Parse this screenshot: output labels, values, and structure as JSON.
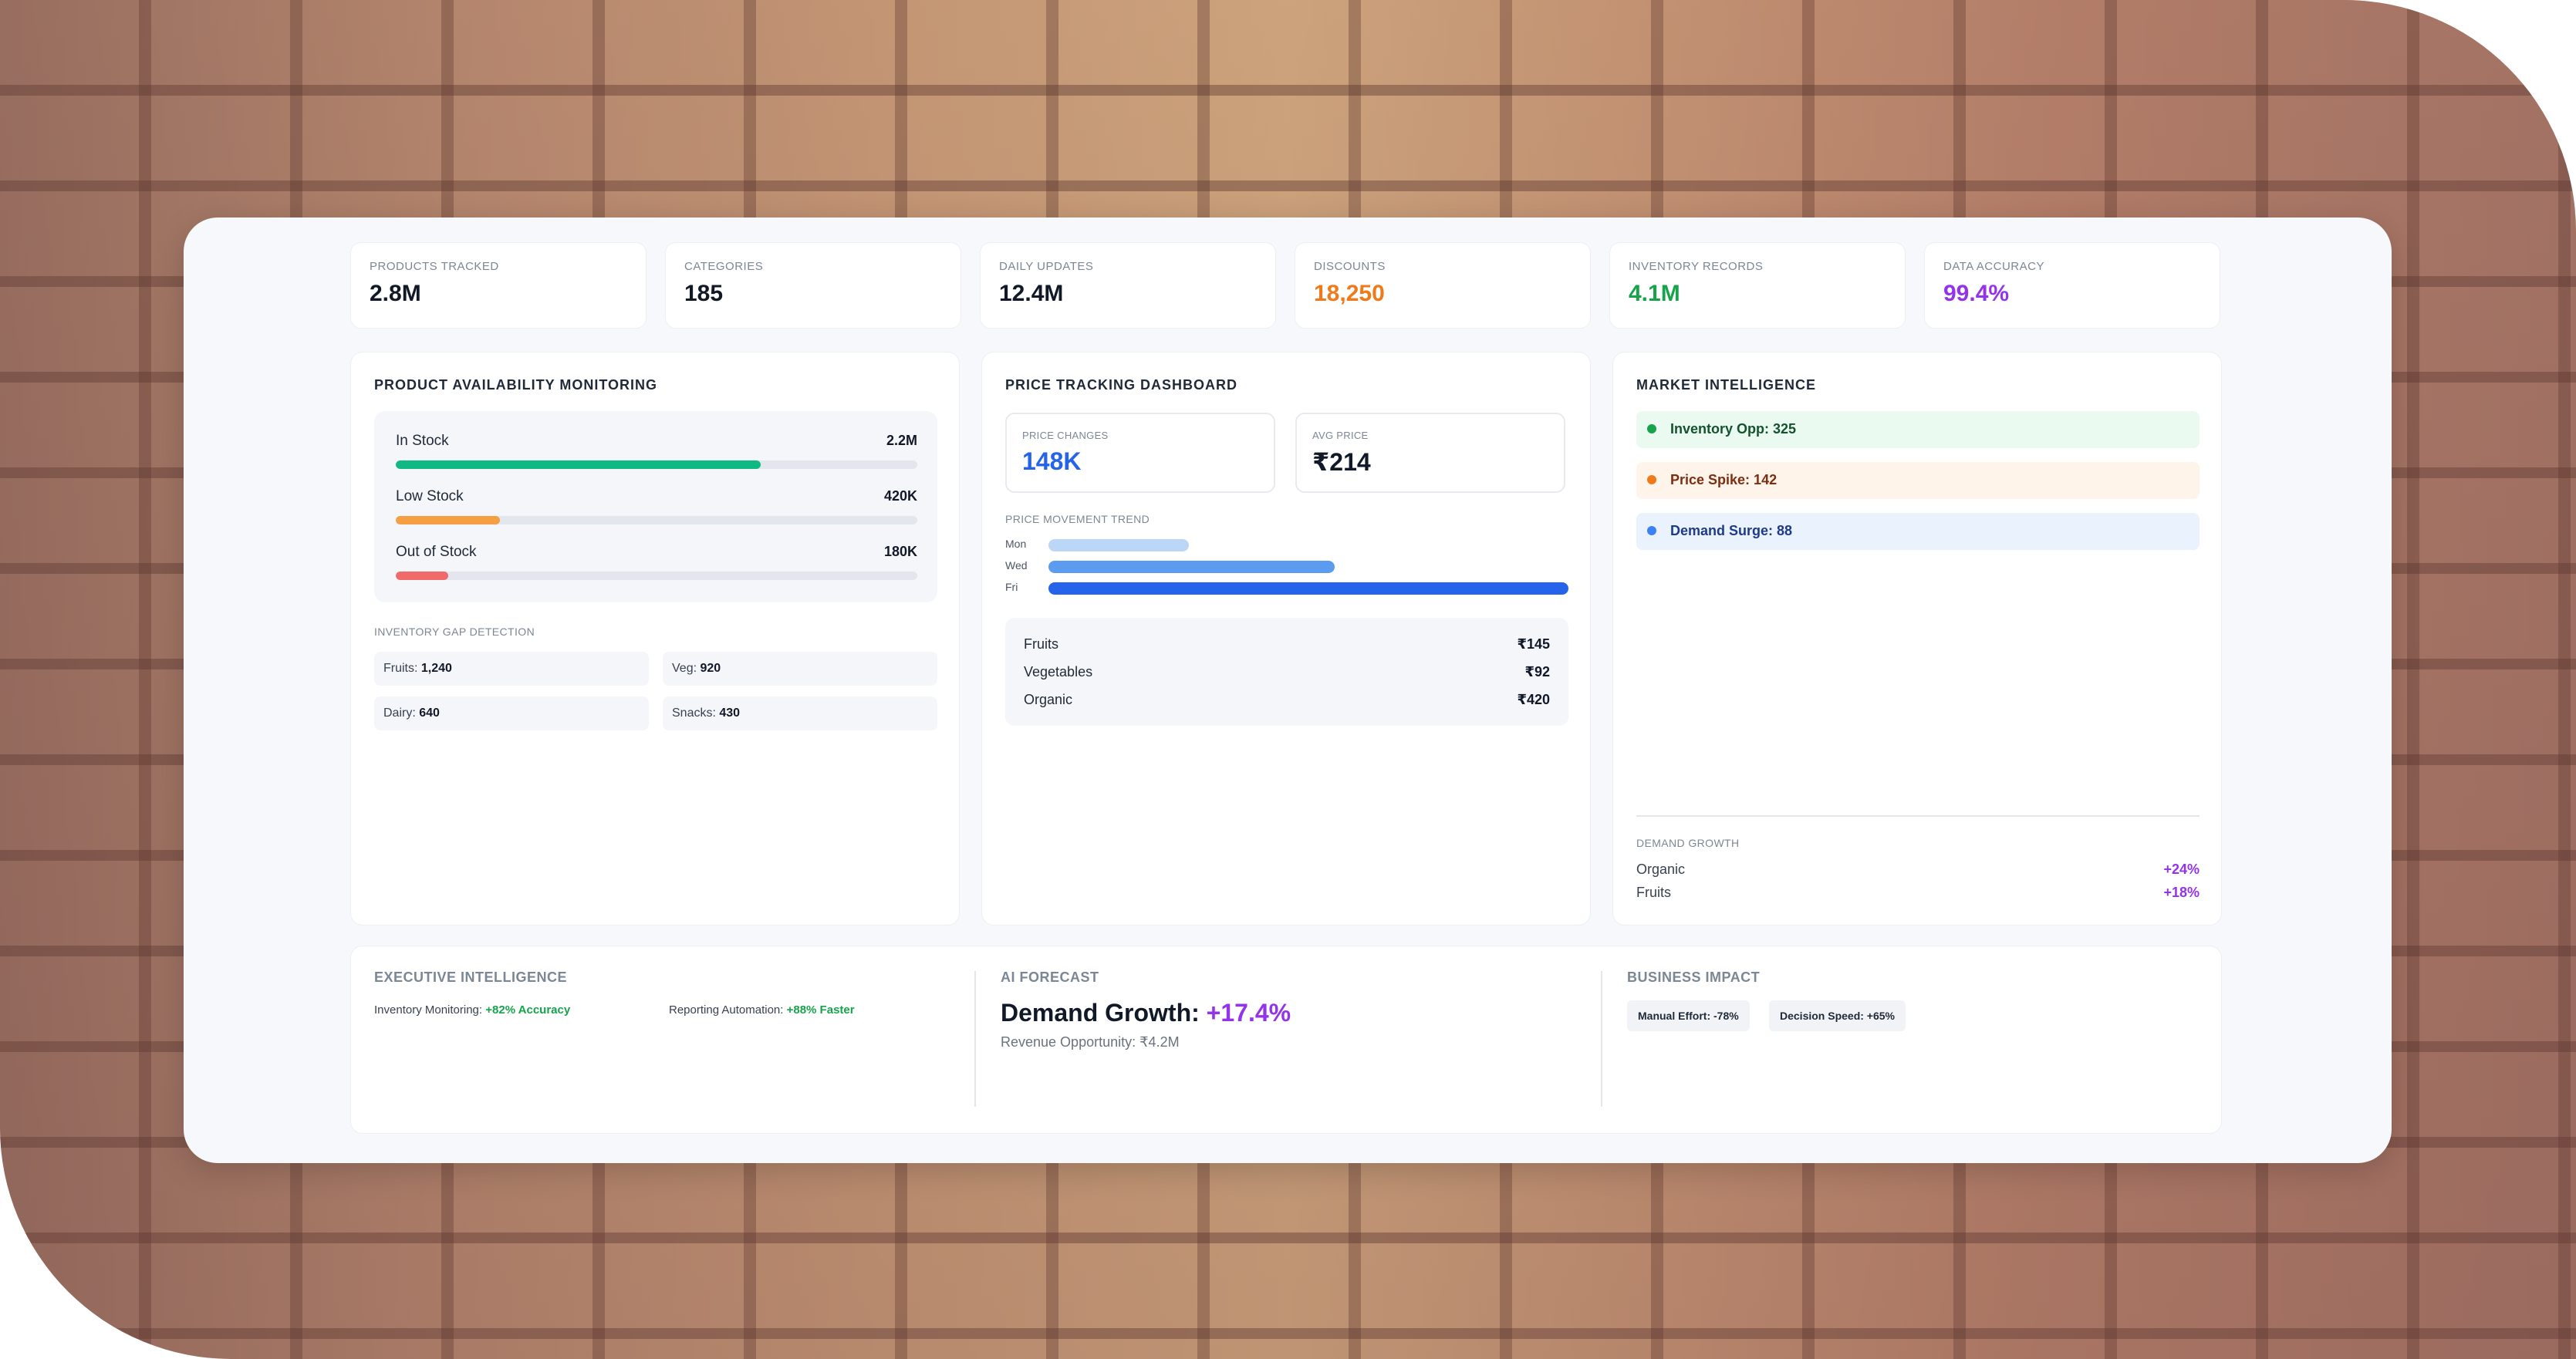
{
  "kpis": [
    {
      "label": "PRODUCTS TRACKED",
      "value": "2.8M",
      "color": "#111827"
    },
    {
      "label": "CATEGORIES",
      "value": "185",
      "color": "#111827"
    },
    {
      "label": "DAILY UPDATES",
      "value": "12.4M",
      "color": "#111827"
    },
    {
      "label": "DISCOUNTS",
      "value": "18,250",
      "color": "#f07a1a"
    },
    {
      "label": "INVENTORY RECORDS",
      "value": "4.1M",
      "color": "#16a34a"
    },
    {
      "label": "DATA ACCURACY",
      "value": "99.4%",
      "color": "#9333ea"
    }
  ],
  "availability": {
    "title": "PRODUCT AVAILABILITY MONITORING",
    "rows": [
      {
        "label": "In Stock",
        "value": "2.2M",
        "fill_pct": 70,
        "color": "#10b981"
      },
      {
        "label": "Low Stock",
        "value": "420K",
        "fill_pct": 20,
        "color": "#f59e42"
      },
      {
        "label": "Out of Stock",
        "value": "180K",
        "fill_pct": 10,
        "color": "#f06a6a"
      }
    ],
    "gap_title": "INVENTORY GAP DETECTION",
    "gaps": [
      {
        "label": "Fruits:",
        "value": "1,240"
      },
      {
        "label": "Veg:",
        "value": "920"
      },
      {
        "label": "Dairy:",
        "value": "640"
      },
      {
        "label": "Snacks:",
        "value": "430"
      }
    ]
  },
  "price": {
    "title": "PRICE TRACKING DASHBOARD",
    "changes_label": "PRICE CHANGES",
    "changes_value": "148K",
    "changes_color": "#2563eb",
    "avg_label": "AVG PRICE",
    "avg_value": "₹214",
    "trend_title": "PRICE MOVEMENT TREND",
    "trend": [
      {
        "day": "Mon",
        "pct": 27,
        "color": "#bcd6f7"
      },
      {
        "day": "Wed",
        "pct": 55,
        "color": "#5b9cf0"
      },
      {
        "day": "Fri",
        "pct": 100,
        "color": "#2563eb"
      }
    ],
    "items": [
      {
        "name": "Fruits",
        "value": "₹145"
      },
      {
        "name": "Vegetables",
        "value": "₹92"
      },
      {
        "name": "Organic",
        "value": "₹420"
      }
    ]
  },
  "market": {
    "title": "MARKET INTELLIGENCE",
    "alerts": [
      {
        "text": "Inventory Opp: 325",
        "bg": "#eafaf1",
        "fg": "#14532d",
        "dot": "#16a34a"
      },
      {
        "text": "Price Spike: 142",
        "bg": "#fff4ea",
        "fg": "#7c2d12",
        "dot": "#f07a1a"
      },
      {
        "text": "Demand Surge: 88",
        "bg": "#eaf3fd",
        "fg": "#1e3a8a",
        "dot": "#3b82f6"
      }
    ],
    "demand_title": "DEMAND GROWTH",
    "demand": [
      {
        "name": "Organic",
        "value": "+24%"
      },
      {
        "name": "Fruits",
        "value": "+18%"
      }
    ]
  },
  "executive": {
    "title": "EXECUTIVE INTELLIGENCE",
    "items": [
      {
        "label": "Inventory Monitoring:",
        "value": "+82% Accuracy"
      },
      {
        "label": "Reporting Automation:",
        "value": "+88% Faster"
      }
    ]
  },
  "forecast": {
    "title": "AI FORECAST",
    "headline": "Demand Growth:",
    "headline_value": "+17.4%",
    "sub": "Revenue Opportunity: ₹4.2M"
  },
  "impact": {
    "title": "BUSINESS IMPACT",
    "chips": [
      "Manual Effort: -78%",
      "Decision Speed: +65%"
    ]
  }
}
